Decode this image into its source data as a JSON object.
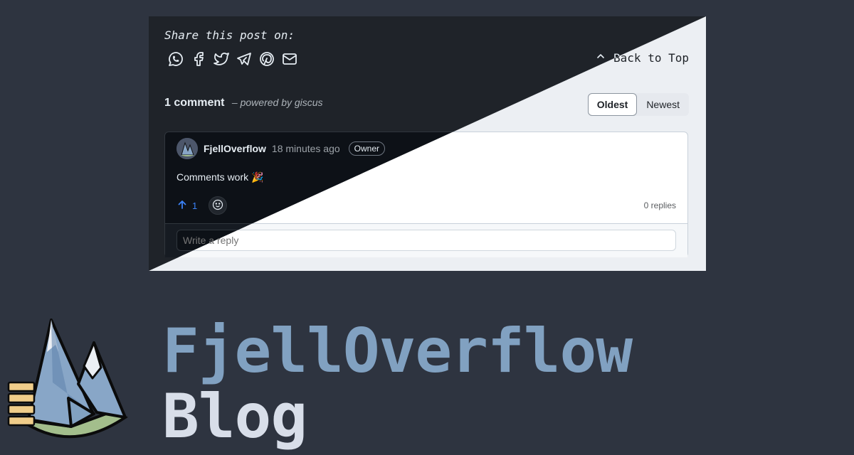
{
  "share": {
    "title": "Share this post on:",
    "icons": [
      "whatsapp-icon",
      "facebook-icon",
      "twitter-icon",
      "telegram-icon",
      "pinterest-icon",
      "mail-icon"
    ]
  },
  "back_to_top": "Back to Top",
  "comments": {
    "count_label": "1 comment",
    "powered_by": "– powered by giscus",
    "sort_options": [
      "Oldest",
      "Newest"
    ],
    "sort_selected": "Oldest",
    "items": [
      {
        "author": "FjellOverflow",
        "time": "18 minutes ago",
        "badge": "Owner",
        "body": "Comments work 🎉",
        "upvotes": "1",
        "replies": "0 replies"
      }
    ],
    "reply_placeholder": "Write a reply"
  },
  "site": {
    "title_line1": "FjellOverflow",
    "title_line2": "Blog"
  },
  "colors": {
    "background": "#2e3440",
    "title_accent": "#81a1c1",
    "title_secondary": "#d8dee9",
    "upvote": "#3b82f6"
  }
}
